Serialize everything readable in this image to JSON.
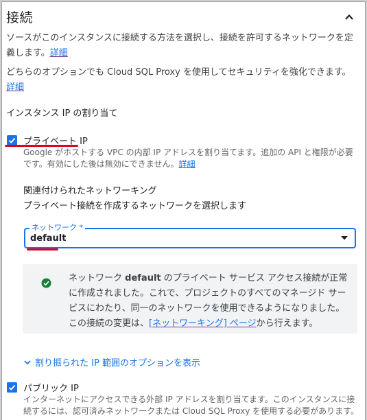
{
  "section": {
    "title": "接続",
    "collapse_icon": "chevron-up-icon"
  },
  "intro": {
    "text": "ソースがこのインスタンスに接続する方法を選択し、接続を許可するネットワークを定義します。",
    "link": "詳細"
  },
  "proxy_note": {
    "text": "どちらのオプションでも Cloud SQL Proxy を使用してセキュリティを強化できます。",
    "link": "詳細"
  },
  "ip_assignment_label": "インスタンス IP の割り当て",
  "private_ip": {
    "checked": true,
    "label": "プライベート IP",
    "help": "Google がホストする VPC の内部 IP アドレスを割り当てます。追加の API と権限が必要です。有効にした後は無効にできません。",
    "help_link": "詳細"
  },
  "networking": {
    "heading": "関連付けられたネットワーキング",
    "description": "プライベート接続を作成するネットワークを選択します",
    "network_label": "ネットワーク *",
    "network_value": "default"
  },
  "status_box": {
    "icon": "check-circle-icon",
    "status_color": "#188038",
    "text_before": "ネットワーク ",
    "network_name": "default",
    "text_after": " のプライベート サービス アクセス接続が正常に作成されました。これで、プロジェクトのすべてのマネージド サービスにわたり、同一のネットワークを使用できるようになりました。この接続の変更は、",
    "link": "[ネットワーキング] ページ",
    "text_end": "から行えます。"
  },
  "expand_link": "割り振られた IP 範囲のオプションを表示",
  "public_ip": {
    "checked": true,
    "label": "パブリック IP",
    "help": "インターネットにアクセスできる外部 IP アドレスを割り当てます。このインスタンスに接続するには、認可済みネットワークまたは Cloud SQL Proxy を使用する必要があります。"
  },
  "colors": {
    "accent": "#1a73e8",
    "annotation_red": "#e0001b",
    "success": "#188038"
  }
}
